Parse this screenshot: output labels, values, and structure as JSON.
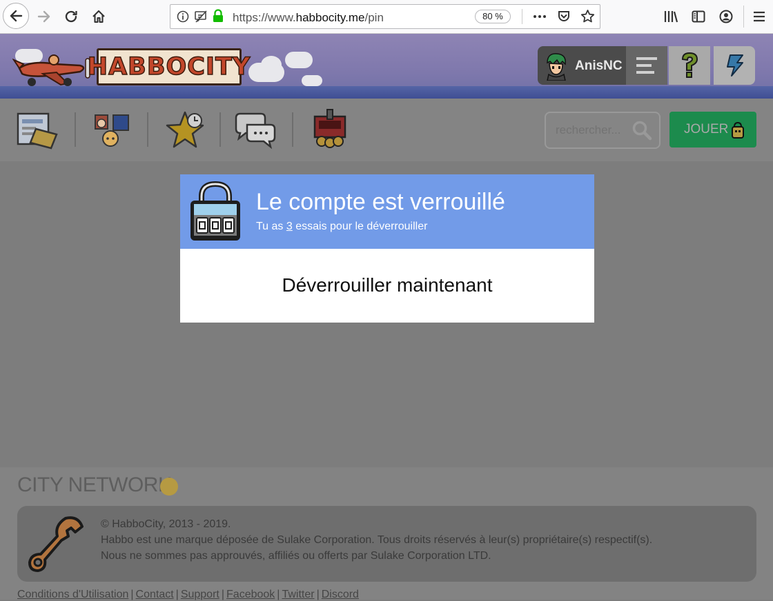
{
  "browser": {
    "url_prefix": "https://www.",
    "url_domain": "habbocity.me",
    "url_path": "/pin",
    "zoom": "80 %"
  },
  "header": {
    "logo_text": "HABBOCITY",
    "username": "AnisNC"
  },
  "nav": {
    "search_placeholder": "rechercher...",
    "play_label": "JOUER"
  },
  "modal": {
    "title": "Le compte est verrouillé",
    "subtitle_before": "Tu as ",
    "attempts": "3",
    "subtitle_after": " essais pour le déverrouiller",
    "unlock_label": "Déverrouiller maintenant"
  },
  "footer": {
    "network_title": "CITY NETWORK",
    "copyright": "© HabboCity, 2013 - 2019.",
    "line2": "Habbo est une marque déposée de Sulake Corporation. Tous droits réservés à leur(s) propriétaire(s) respectif(s).",
    "line3": "Nous ne sommes pas approuvés, affiliés ou offerts par Sulake Corporation LTD.",
    "links": [
      "Conditions d'Utilisation",
      "Contact",
      "Support",
      "Facebook",
      "Twitter",
      "Discord"
    ],
    "link_separator": "|"
  },
  "colors": {
    "modal_header": "#729be8",
    "play_button": "#1c8b4d",
    "overlay": "#7d7d7d"
  }
}
